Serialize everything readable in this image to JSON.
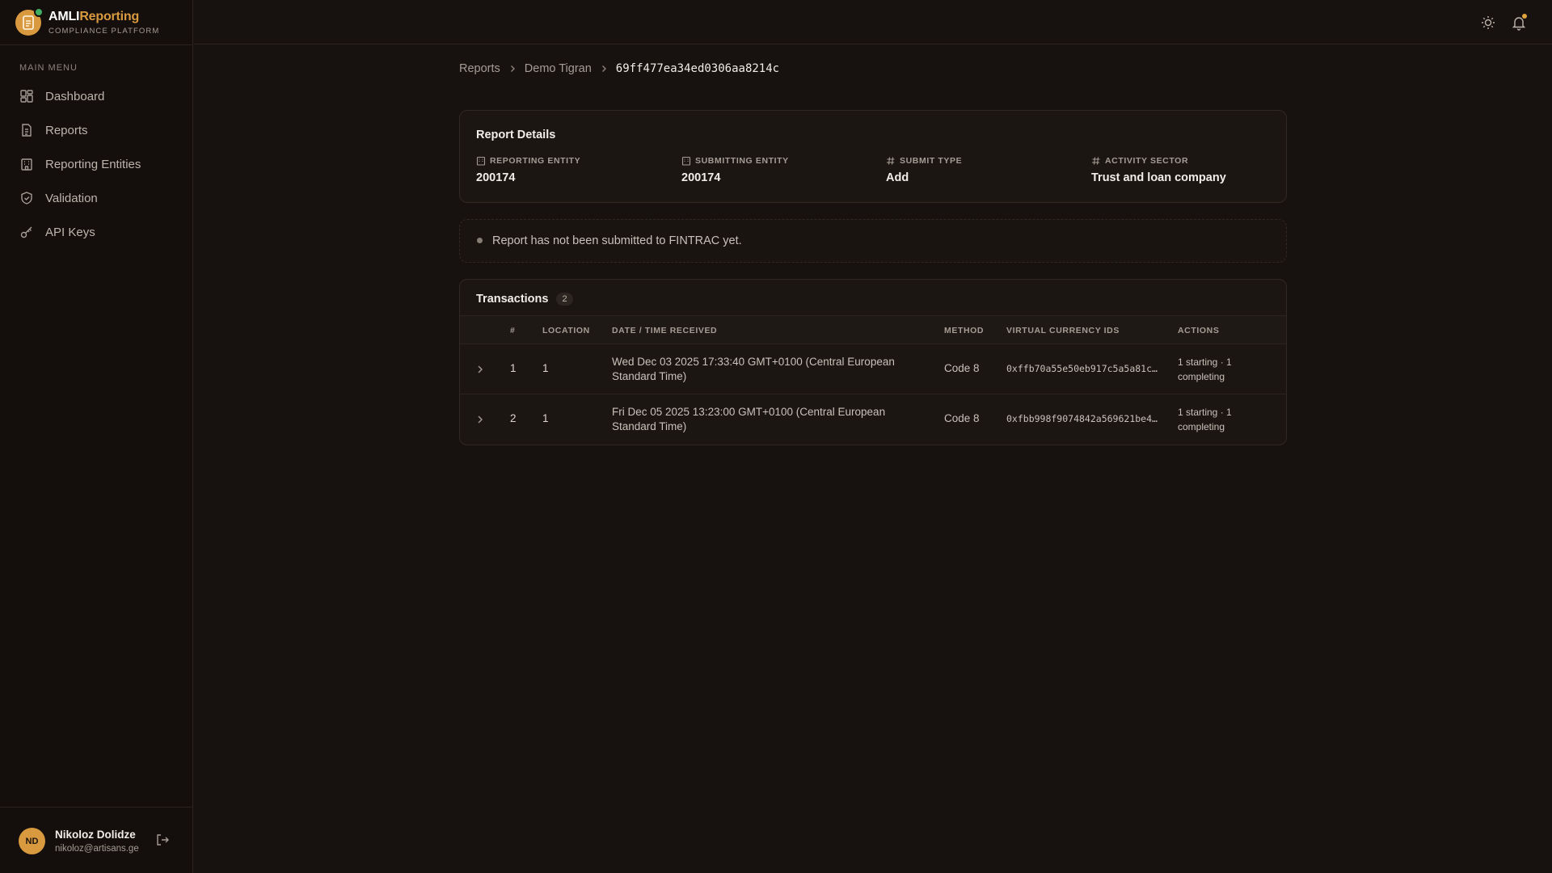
{
  "app": {
    "name_part1": "AMLI",
    "name_part2": "Reporting",
    "subtitle": "COMPLIANCE PLATFORM",
    "accent_color": "#d99a3f"
  },
  "sidebar": {
    "heading": "MAIN MENU",
    "items": [
      {
        "label": "Dashboard",
        "icon": "dashboard-icon"
      },
      {
        "label": "Reports",
        "icon": "file-icon"
      },
      {
        "label": "Reporting Entities",
        "icon": "building-icon"
      },
      {
        "label": "Validation",
        "icon": "shield-check-icon"
      },
      {
        "label": "API Keys",
        "icon": "key-icon"
      }
    ]
  },
  "user": {
    "initials": "ND",
    "name": "Nikoloz Dolidze",
    "email": "nikoloz@artisans.ge"
  },
  "breadcrumb": {
    "items": [
      "Reports",
      "Demo Tigran"
    ],
    "current": "69ff477ea34ed0306aa8214c"
  },
  "details": {
    "title": "Report Details",
    "fields": [
      {
        "label": "REPORTING ENTITY",
        "value": "200174",
        "icon": "building-icon"
      },
      {
        "label": "SUBMITTING ENTITY",
        "value": "200174",
        "icon": "building-icon"
      },
      {
        "label": "SUBMIT TYPE",
        "value": "Add",
        "icon": "hash-icon"
      },
      {
        "label": "ACTIVITY SECTOR",
        "value": "Trust and loan company",
        "icon": "hash-icon"
      }
    ]
  },
  "notice": {
    "text": "Report has not been submitted to FINTRAC yet."
  },
  "transactions": {
    "title": "Transactions",
    "count": "2",
    "columns": [
      "#",
      "LOCATION",
      "DATE / TIME RECEIVED",
      "METHOD",
      "VIRTUAL CURRENCY IDS",
      "ACTIONS"
    ],
    "rows": [
      {
        "num": "1",
        "location": "1",
        "date": "Wed Dec 03 2025 17:33:40 GMT+0100 (Central European Standard Time)",
        "method": "Code 8",
        "vc_ids": "0xffb70a55e50eb917c5a5a81c…",
        "actions": "1 starting · 1 completing"
      },
      {
        "num": "2",
        "location": "1",
        "date": "Fri Dec 05 2025 13:23:00 GMT+0100 (Central European Standard Time)",
        "method": "Code 8",
        "vc_ids": "0xfbb998f9074842a569621be4…",
        "actions": "1 starting · 1 completing"
      }
    ]
  }
}
